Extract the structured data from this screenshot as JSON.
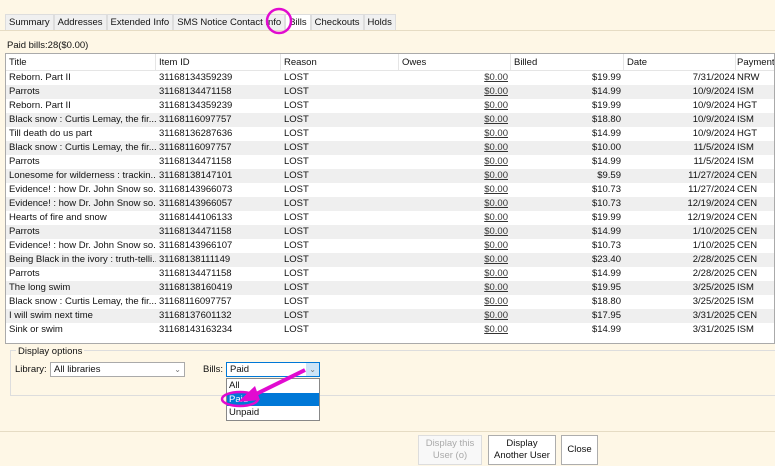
{
  "tabs": [
    "Summary",
    "Addresses",
    "Extended Info",
    "SMS Notice Contact Info",
    "Bills",
    "Checkouts",
    "Holds"
  ],
  "active_tab": "Bills",
  "summary": "Paid bills:28($0.00)",
  "columns": [
    "Title",
    "Item ID",
    "Reason",
    "Owes",
    "Billed",
    "Date",
    "Payment"
  ],
  "rows": [
    [
      "Reborn. Part II",
      "31168134359239",
      "LOST",
      "$0.00",
      "$19.99",
      "7/31/2024",
      "NRW"
    ],
    [
      "Parrots",
      "31168134471158",
      "LOST",
      "$0.00",
      "$14.99",
      "10/9/2024",
      "ISM"
    ],
    [
      "Reborn. Part II",
      "31168134359239",
      "LOST",
      "$0.00",
      "$19.99",
      "10/9/2024",
      "HGT"
    ],
    [
      "Black snow : Curtis Lemay, the fir...",
      "31168116097757",
      "LOST",
      "$0.00",
      "$18.80",
      "10/9/2024",
      "ISM"
    ],
    [
      "Till death do us part",
      "31168136287636",
      "LOST",
      "$0.00",
      "$14.99",
      "10/9/2024",
      "HGT"
    ],
    [
      "Black snow : Curtis Lemay, the fir...",
      "31168116097757",
      "LOST",
      "$0.00",
      "$10.00",
      "11/5/2024",
      "ISM"
    ],
    [
      "Parrots",
      "31168134471158",
      "LOST",
      "$0.00",
      "$14.99",
      "11/5/2024",
      "ISM"
    ],
    [
      "Lonesome for wilderness : trackin...",
      "31168138147101",
      "LOST",
      "$0.00",
      "$9.59",
      "11/27/2024",
      "CEN"
    ],
    [
      "Evidence! : how Dr. John Snow so...",
      "31168143966073",
      "LOST",
      "$0.00",
      "$10.73",
      "11/27/2024",
      "CEN"
    ],
    [
      "Evidence! : how Dr. John Snow so...",
      "31168143966057",
      "LOST",
      "$0.00",
      "$10.73",
      "12/19/2024",
      "CEN"
    ],
    [
      "Hearts of fire and snow",
      "31168144106133",
      "LOST",
      "$0.00",
      "$19.99",
      "12/19/2024",
      "CEN"
    ],
    [
      "Parrots",
      "31168134471158",
      "LOST",
      "$0.00",
      "$14.99",
      "1/10/2025",
      "CEN"
    ],
    [
      "Evidence! : how Dr. John Snow so...",
      "31168143966107",
      "LOST",
      "$0.00",
      "$10.73",
      "1/10/2025",
      "CEN"
    ],
    [
      "Being Black in the ivory : truth-telli...",
      "31168138111149",
      "LOST",
      "$0.00",
      "$23.40",
      "2/28/2025",
      "CEN"
    ],
    [
      "Parrots",
      "31168134471158",
      "LOST",
      "$0.00",
      "$14.99",
      "2/28/2025",
      "CEN"
    ],
    [
      "The long swim",
      "31168138160419",
      "LOST",
      "$0.00",
      "$19.95",
      "3/25/2025",
      "ISM"
    ],
    [
      "Black snow : Curtis Lemay, the fir...",
      "31168116097757",
      "LOST",
      "$0.00",
      "$18.80",
      "3/25/2025",
      "ISM"
    ],
    [
      "I will swim next time",
      "31168137601132",
      "LOST",
      "$0.00",
      "$17.95",
      "3/31/2025",
      "CEN"
    ],
    [
      "Sink or swim",
      "31168143163234",
      "LOST",
      "$0.00",
      "$14.99",
      "3/31/2025",
      "ISM"
    ]
  ],
  "display_options": {
    "title": "Display options",
    "library_label": "Library:",
    "library_value": "All libraries",
    "bills_label": "Bills:",
    "bills_value": "Paid",
    "bills_options": [
      "All",
      "Paid",
      "Unpaid"
    ],
    "selected_option": "Paid"
  },
  "buttons": {
    "display_this_user": "Display this User (o)",
    "display_another_user": "Display Another User",
    "close": "Close"
  },
  "annotation_color": "#e10bd0"
}
